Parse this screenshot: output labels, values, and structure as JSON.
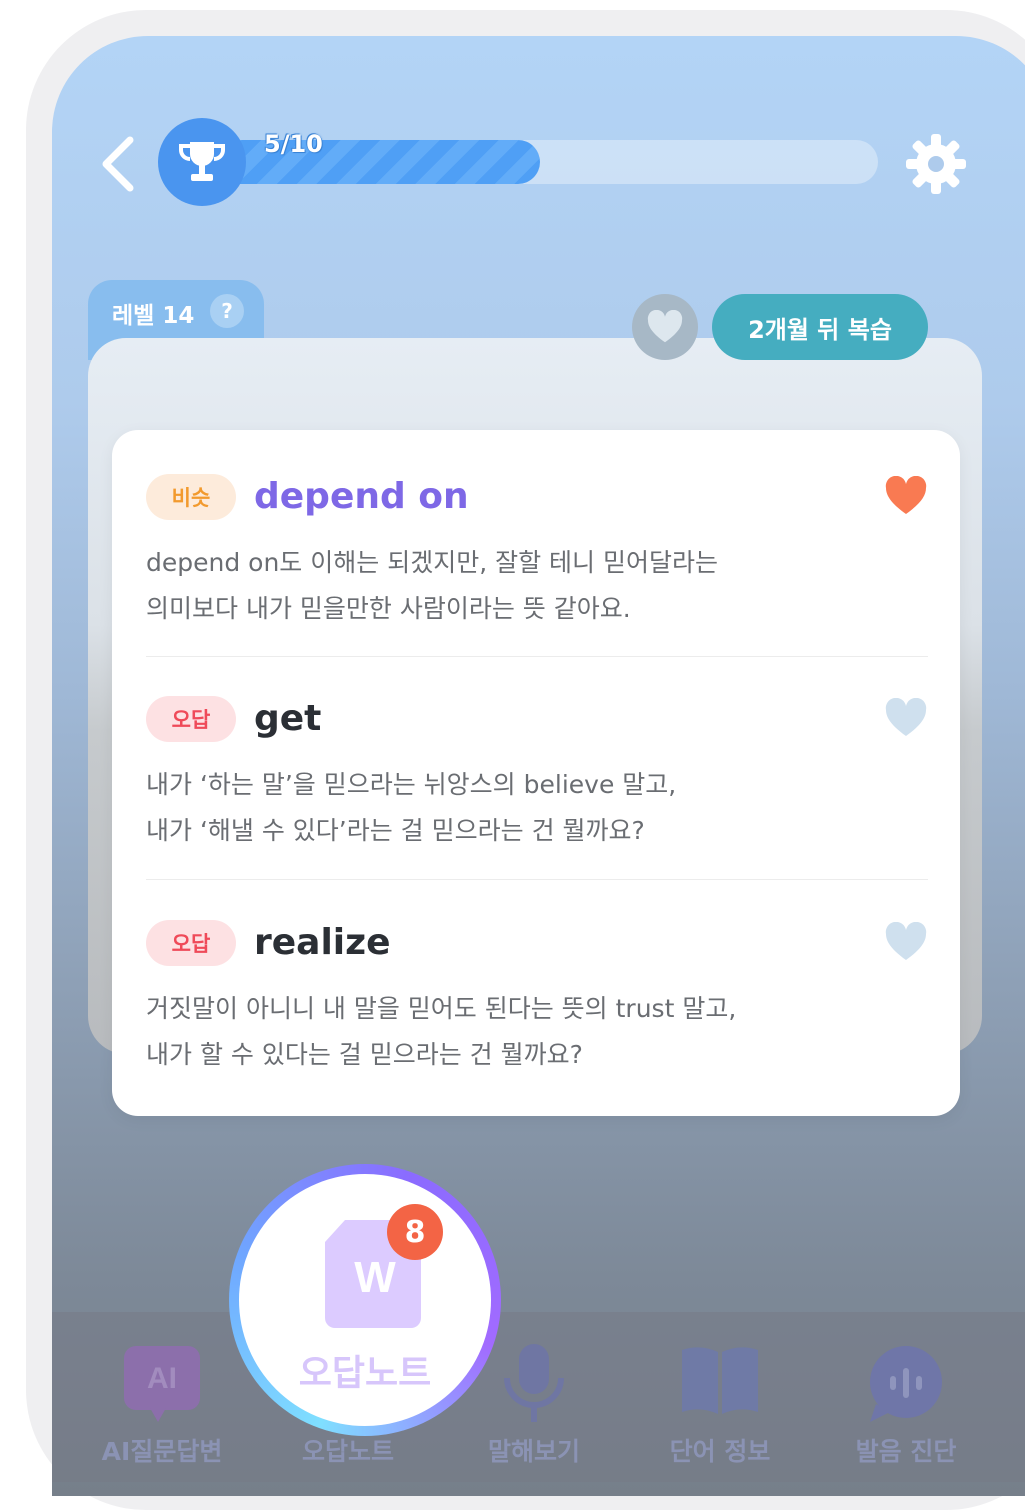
{
  "header": {
    "back_icon": "chevron-left-icon",
    "trophy_icon": "trophy-icon",
    "progress_text": "5/10",
    "progress": {
      "current": 5,
      "total": 10
    },
    "settings_icon": "gear-icon"
  },
  "card": {
    "level_label": "레벨 14",
    "help_label": "?",
    "review_label": "2개월 뒤 복습",
    "heart_icon": "heart-icon"
  },
  "options": [
    {
      "badge": "비슷",
      "word": "depend on",
      "desc_line1": "depend on도 이해는 되겠지만, 잘할 테니 믿어달라는",
      "desc_line2": "의미보다 내가 믿을만한 사람이라는 뜻 같아요.",
      "liked": true
    },
    {
      "badge": "오답",
      "word": "get",
      "desc_line1": "내가 ‘하는 말’을 믿으라는 뉘앙스의 believe 말고,",
      "desc_line2": "내가 ‘해낼 수 있다’라는 걸 믿으라는 건 뭘까요?",
      "liked": false
    },
    {
      "badge": "오답",
      "word": "realize",
      "desc_line1": "거짓말이 아니니 내 말을 믿어도 된다는 뜻의 trust 말고,",
      "desc_line2": "내가 할 수 있다는 걸 믿으라는 건 뭘까요?",
      "liked": false
    }
  ],
  "fab": {
    "icon_letter": "W",
    "badge_count": "8",
    "label": "오답노트"
  },
  "nav": [
    {
      "label": "AI질문답변",
      "icon": "ai-chat-icon",
      "icon_text": "AI"
    },
    {
      "label": "오답노트",
      "icon": "wrong-note-icon"
    },
    {
      "label": "말해보기",
      "icon": "microphone-icon"
    },
    {
      "label": "단어 정보",
      "icon": "book-icon"
    },
    {
      "label": "발음 진단",
      "icon": "pronunciation-icon"
    }
  ],
  "colors": {
    "accent_purple": "#7e68e6",
    "similar_badge": "#f29a2e",
    "wrong_badge": "#ef4a59",
    "liked_heart": "#f97a52",
    "review_pill": "#45adc0"
  }
}
